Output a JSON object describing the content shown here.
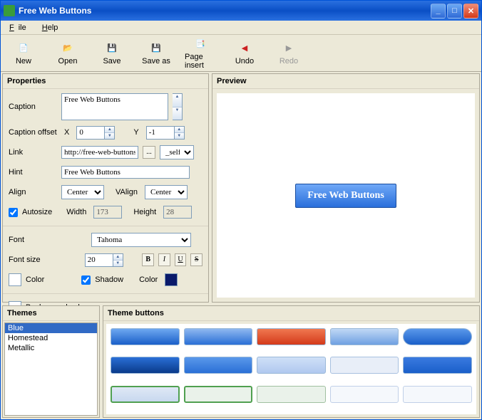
{
  "window": {
    "title": "Free Web Buttons"
  },
  "menu": {
    "file": "File",
    "help": "Help"
  },
  "toolbar": {
    "new": "New",
    "open": "Open",
    "save": "Save",
    "saveas": "Save as",
    "pageinsert": "Page insert",
    "undo": "Undo",
    "redo": "Redo"
  },
  "panels": {
    "properties": "Properties",
    "preview": "Preview",
    "themes": "Themes",
    "themebuttons": "Theme buttons"
  },
  "props": {
    "caption_label": "Caption",
    "caption": "Free Web Buttons",
    "offset_label": "Caption offset",
    "x_label": "X",
    "x": "0",
    "y_label": "Y",
    "y": "-1",
    "link_label": "Link",
    "link": "http://free-web-buttons",
    "target": "_self",
    "hint_label": "Hint",
    "hint": "Free Web Buttons",
    "align_label": "Align",
    "align": "Center",
    "valign_label": "VAlign",
    "valign": "Center",
    "autosize_label": "Autosize",
    "width_label": "Width",
    "width": "173",
    "height_label": "Height",
    "height": "28",
    "font_label": "Font",
    "font": "Tahoma",
    "fontsize_label": "Font size",
    "fontsize": "20",
    "color_label": "Color",
    "shadow_label": "Shadow",
    "shadow_color_label": "Color",
    "bgcolor_label": "Background color"
  },
  "format": {
    "bold": "B",
    "italic": "I",
    "underline": "U",
    "strike": "S"
  },
  "preview": {
    "button_text": "Free Web Buttons"
  },
  "themes": {
    "items": [
      "Blue",
      "Homestead",
      "Metallic"
    ],
    "selected": 0
  },
  "swatches": [
    {
      "bg": "linear-gradient(#6ea8f0,#1a5fc9)"
    },
    {
      "bg": "linear-gradient(#8fb8f0,#2a6fd6)"
    },
    {
      "bg": "linear-gradient(#f07850,#d43a1a)"
    },
    {
      "bg": "linear-gradient(#c0d8f5,#6fa0e2)"
    },
    {
      "bg": "linear-gradient(#5a98ea,#1a5fc9)",
      "radius": "12px"
    },
    {
      "bg": "linear-gradient(#2a6fd6,#0a3a8a)"
    },
    {
      "bg": "linear-gradient(#5a98ea,#2a6fd6)"
    },
    {
      "bg": "linear-gradient(#cfe0f7,#b0c8ef)"
    },
    {
      "bg": "#e8eef8",
      "border": "1px solid #a8c0e0"
    },
    {
      "bg": "linear-gradient(#3a7ae0,#1a5fc9)"
    },
    {
      "bg": "linear-gradient(#dfe8f5,#c8d8ef)",
      "border": "2px solid #50a050"
    },
    {
      "bg": "#eaf2ea",
      "border": "2px solid #50a050"
    },
    {
      "bg": "#eaf2ea",
      "border": "1px solid #a0c0a0"
    },
    {
      "bg": "#f5f8fc",
      "border": "1px solid #c0d0e8"
    },
    {
      "bg": "#f5f8fc",
      "border": "1px solid #c0d0e8"
    }
  ]
}
